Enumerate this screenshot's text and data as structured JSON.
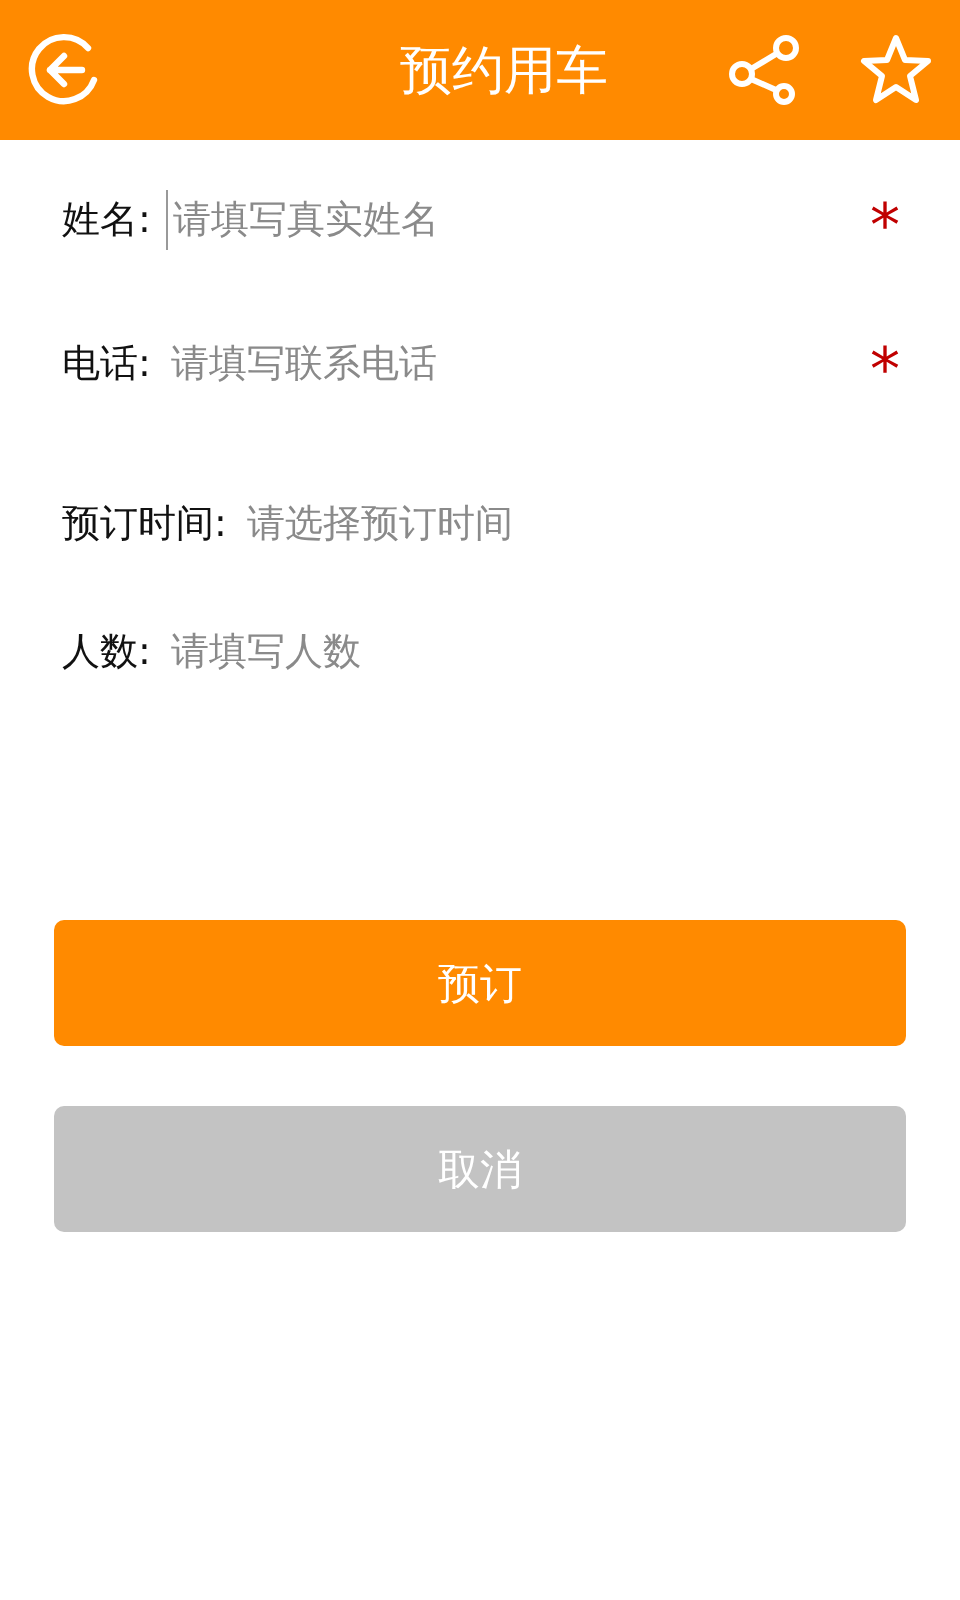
{
  "header": {
    "title": "预约用车"
  },
  "fields": [
    {
      "label": "姓名:",
      "placeholder": "请填写真实姓名",
      "focused": true,
      "required_mark": "*"
    },
    {
      "label": "电话:",
      "placeholder": "请填写联系电话",
      "focused": false,
      "required_mark": "*"
    },
    {
      "label": "预订时间:",
      "placeholder": "请选择预订时间",
      "focused": false
    },
    {
      "label": "人数:",
      "placeholder": "请填写人数",
      "focused": false
    }
  ],
  "buttons": [
    {
      "label": "预订",
      "kind": "primary"
    },
    {
      "label": "取消",
      "kind": "secondary"
    }
  ]
}
